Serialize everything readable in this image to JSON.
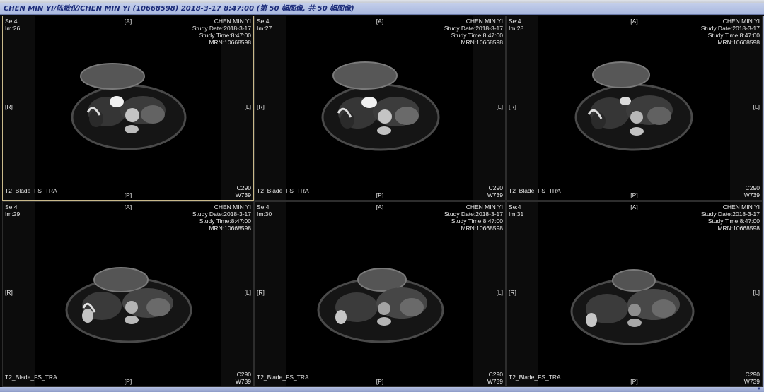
{
  "window": {
    "title": "CHEN MIN YI/陈敏仪/CHEN MIN YI (10668598) 2018-3-17 8:47:00 (第 50 幅图像, 共 50 幅图像)"
  },
  "viewports": [
    {
      "se": "Se:4",
      "im": "Im:26",
      "patient": "CHEN MIN YI",
      "study_date": "Study Date:2018-3-17",
      "study_time": "Study Time:8:47:00",
      "mrn": "MRN:10668598",
      "ori_top": "[A]",
      "ori_bottom": "[P]",
      "ori_left": "[R]",
      "ori_right": "[L]",
      "series": "T2_Blade_FS_TRA",
      "center": "C290",
      "width": "W739"
    },
    {
      "se": "Se:4",
      "im": "Im:27",
      "patient": "CHEN MIN YI",
      "study_date": "Study Date:2018-3-17",
      "study_time": "Study Time:8:47:00",
      "mrn": "MRN:10668598",
      "ori_top": "[A]",
      "ori_bottom": "[P]",
      "ori_left": "[R]",
      "ori_right": "[L]",
      "series": "T2_Blade_FS_TRA",
      "center": "C290",
      "width": "W739"
    },
    {
      "se": "Se:4",
      "im": "Im:28",
      "patient": "CHEN MIN YI",
      "study_date": "Study Date:2018-3-17",
      "study_time": "Study Time:8:47:00",
      "mrn": "MRN:10668598",
      "ori_top": "[A]",
      "ori_bottom": "[P]",
      "ori_left": "[R]",
      "ori_right": "[L]",
      "series": "T2_Blade_FS_TRA",
      "center": "C290",
      "width": "W739"
    },
    {
      "se": "Se:4",
      "im": "Im:29",
      "patient": "CHEN MIN YI",
      "study_date": "Study Date:2018-3-17",
      "study_time": "Study Time:8:47:00",
      "mrn": "MRN:10668598",
      "ori_top": "[A]",
      "ori_bottom": "[P]",
      "ori_left": "[R]",
      "ori_right": "[L]",
      "series": "T2_Blade_FS_TRA",
      "center": "C290",
      "width": "W739"
    },
    {
      "se": "Se:4",
      "im": "Im:30",
      "patient": "CHEN MIN YI",
      "study_date": "Study Date:2018-3-17",
      "study_time": "Study Time:8:47:00",
      "mrn": "MRN:10668598",
      "ori_top": "[A]",
      "ori_bottom": "[P]",
      "ori_left": "[R]",
      "ori_right": "[L]",
      "series": "T2_Blade_FS_TRA",
      "center": "C290",
      "width": "W739"
    },
    {
      "se": "Se:4",
      "im": "Im:31",
      "patient": "CHEN MIN YI",
      "study_date": "Study Date:2018-3-17",
      "study_time": "Study Time:8:47:00",
      "mrn": "MRN:10668598",
      "ori_top": "[A]",
      "ori_bottom": "[P]",
      "ori_left": "[R]",
      "ori_right": "[L]",
      "series": "T2_Blade_FS_TRA",
      "center": "C290",
      "width": "W739"
    }
  ],
  "colors": {
    "titlebar_text": "#1a2a78",
    "overlay_text": "#e8e8e8",
    "active_border": "#c9b98a"
  },
  "icons": {
    "scroll_down": "scroll-down-arrow-icon"
  }
}
